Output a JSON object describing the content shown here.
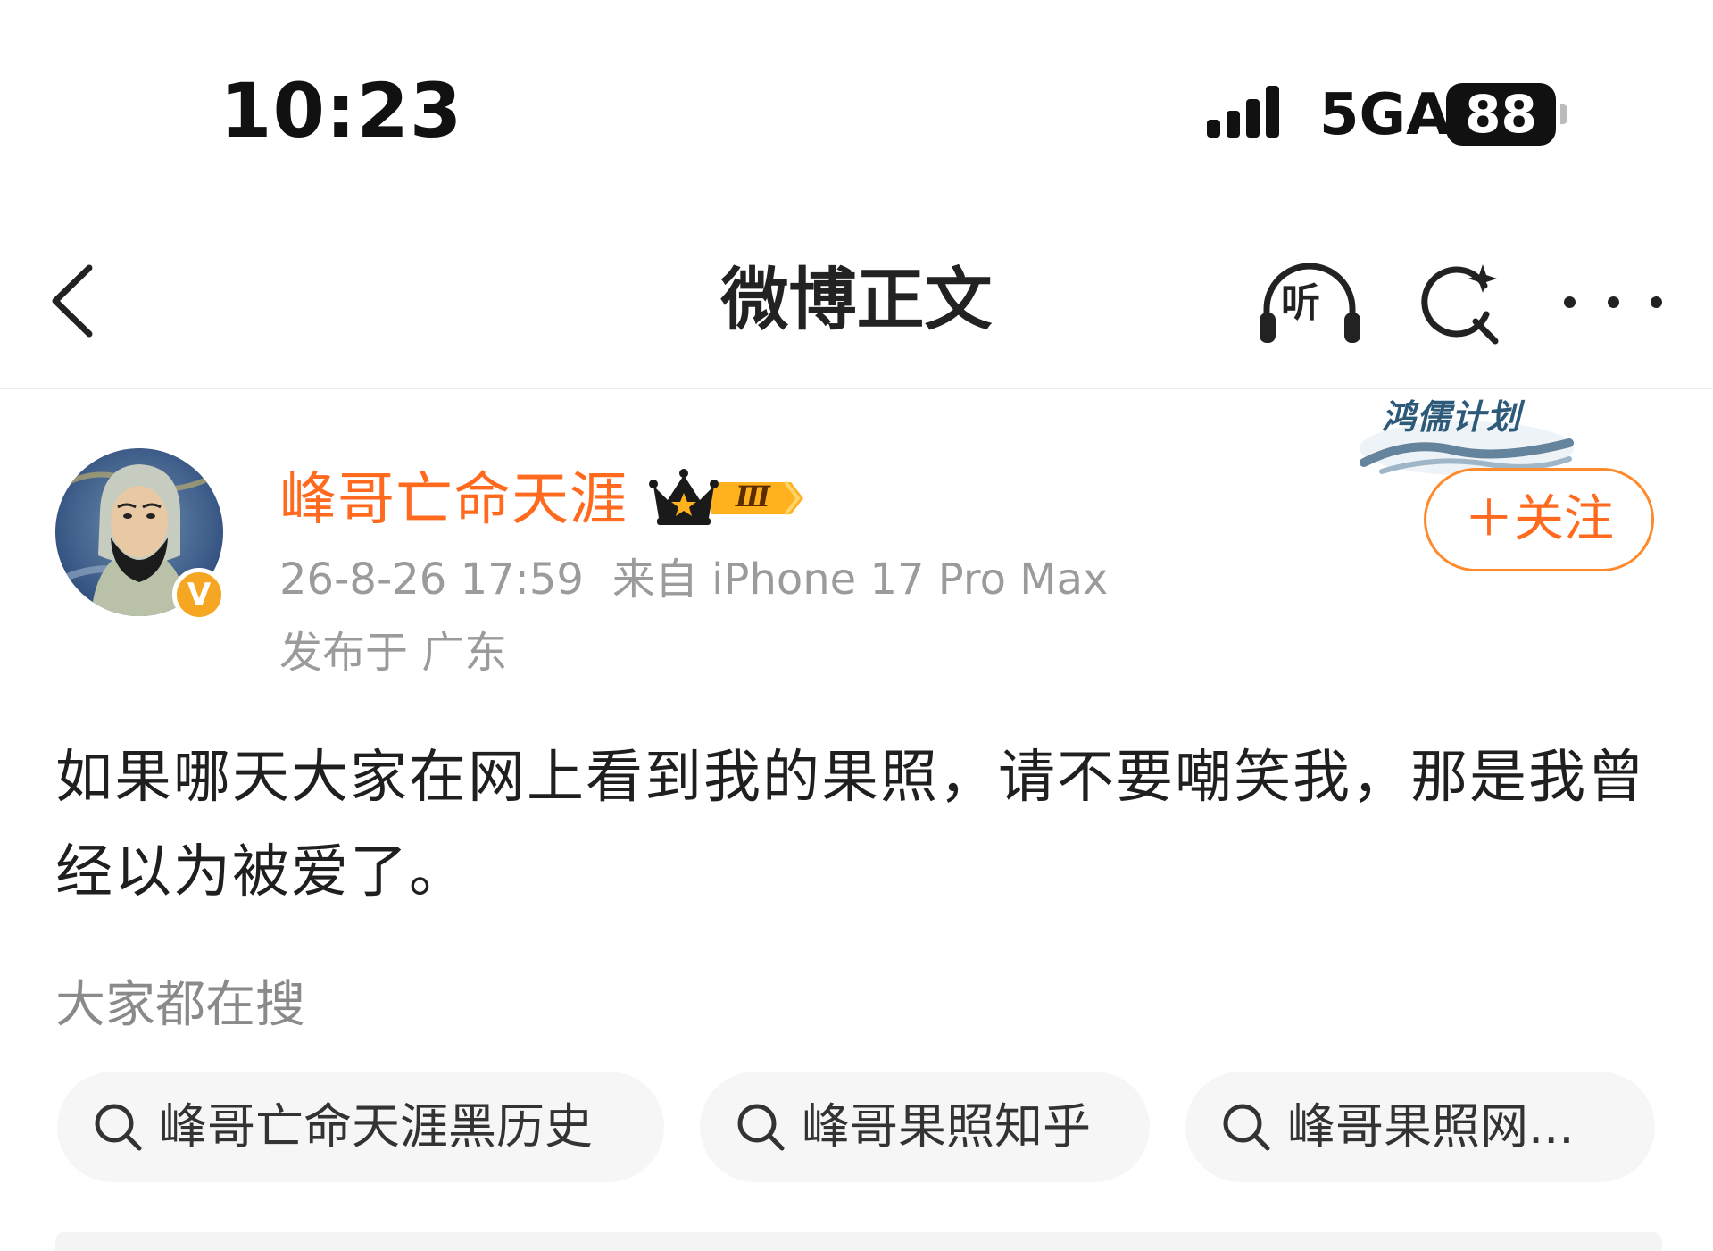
{
  "status_bar": {
    "time": "10:23",
    "network": "5GA",
    "battery": "88",
    "signal_icon": "signal-bars-icon"
  },
  "nav": {
    "title": "微博正文",
    "back_icon": "chevron-left-icon",
    "listen_label": "听",
    "listen_icon": "headphones-icon",
    "search_icon": "ai-search-icon",
    "more_icon": "more-dots-icon"
  },
  "author": {
    "name": "峰哥亡命天涯",
    "level_badge": "Ⅲ",
    "level_icon": "crown-icon",
    "verified_icon": "verified-v-icon",
    "verified_label": "V",
    "date": "26-8-26 17:59",
    "source": "来自 iPhone 17 Pro Max",
    "location": "发布于 广东",
    "plan_badge": "鸿儒计划",
    "follow_label": "＋关注"
  },
  "post": {
    "content": "如果哪天大家在网上看到我的果照，请不要嘲笑我，那是我曾经以为被爱了。"
  },
  "suggestions": {
    "title": "大家都在搜",
    "items": [
      {
        "label": "峰哥亡命天涯黑历史",
        "icon": "search-icon"
      },
      {
        "label": "峰哥果照知乎",
        "icon": "search-icon"
      },
      {
        "label": "峰哥果照网...",
        "icon": "search-icon"
      }
    ]
  },
  "colors": {
    "accent": "#ff6a1f",
    "follow_border": "#ff8a2b",
    "meta_text": "#9b9b9b",
    "chip_bg": "#f6f6f6",
    "verified": "#f5a623"
  }
}
